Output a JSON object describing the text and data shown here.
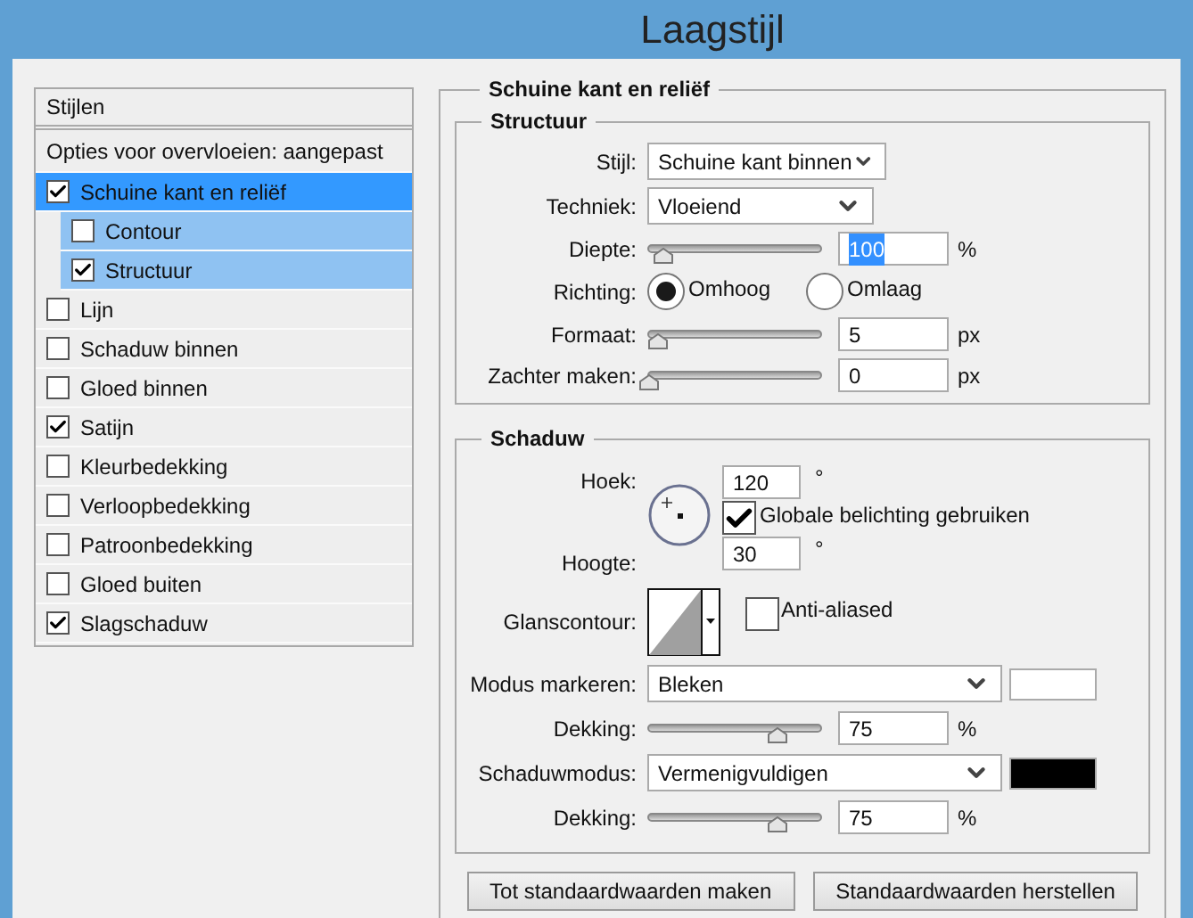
{
  "window": {
    "title": "Laagstijl"
  },
  "sidebar": {
    "header": "Stijlen",
    "blending_options": "Opties voor overvloeien: aangepast",
    "items": [
      {
        "label": "Schuine kant en reliëf",
        "checked": true,
        "selected": true,
        "children": [
          {
            "label": "Contour",
            "checked": false
          },
          {
            "label": "Structuur",
            "checked": true
          }
        ]
      },
      {
        "label": "Lijn",
        "checked": false,
        "selected": false
      },
      {
        "label": "Schaduw binnen",
        "checked": false,
        "selected": false
      },
      {
        "label": "Gloed binnen",
        "checked": false,
        "selected": false
      },
      {
        "label": "Satijn",
        "checked": true,
        "selected": false
      },
      {
        "label": "Kleurbedekking",
        "checked": false,
        "selected": false
      },
      {
        "label": "Verloopbedekking",
        "checked": false,
        "selected": false
      },
      {
        "label": "Patroonbedekking",
        "checked": false,
        "selected": false
      },
      {
        "label": "Gloed buiten",
        "checked": false,
        "selected": false
      },
      {
        "label": "Slagschaduw",
        "checked": true,
        "selected": false
      }
    ]
  },
  "panel": {
    "title": "Schuine kant en reliëf",
    "structure": {
      "title": "Structuur",
      "style": {
        "label": "Stijl:",
        "value": "Schuine kant binnen"
      },
      "technique": {
        "label": "Techniek:",
        "value": "Vloeiend"
      },
      "depth": {
        "label": "Diepte:",
        "level": 0.08,
        "value": "100",
        "unit": "%",
        "text_selected": true
      },
      "direction": {
        "label": "Richting:",
        "options": [
          {
            "label": "Omhoog",
            "selected": true
          },
          {
            "label": "Omlaag",
            "selected": false
          }
        ]
      },
      "size": {
        "label": "Formaat:",
        "level": 0.05,
        "value": "5",
        "unit": "px",
        "text_selected": false
      },
      "soften": {
        "label": "Zachter maken:",
        "level": 0,
        "value": "0",
        "unit": "px",
        "text_selected": false
      }
    },
    "shading": {
      "title": "Schaduw",
      "angle": {
        "label": "Hoek:",
        "value": "120",
        "unit": "°"
      },
      "global_light": {
        "label": "Globale belichting gebruiken",
        "checked": true
      },
      "altitude": {
        "label": "Hoogte:",
        "value": "30",
        "unit": "°"
      },
      "gloss_contour": {
        "label": "Glanscontour:"
      },
      "anti_aliased": {
        "label": "Anti-aliased",
        "checked": false
      },
      "highlight_mode": {
        "label": "Modus markeren:",
        "value": "Bleken",
        "color": "#ffffff"
      },
      "highlight_opacity": {
        "label": "Dekking:",
        "level": 0.75,
        "value": "75",
        "unit": "%",
        "text_selected": false
      },
      "shadow_mode": {
        "label": "Schaduwmodus:",
        "value": "Vermenigvuldigen",
        "color": "#000000"
      },
      "shadow_opacity": {
        "label": "Dekking:",
        "level": 0.75,
        "value": "75",
        "unit": "%",
        "text_selected": false
      }
    }
  },
  "buttons": [
    "Tot standaardwaarden maken",
    "Standaardwaarden herstellen"
  ]
}
